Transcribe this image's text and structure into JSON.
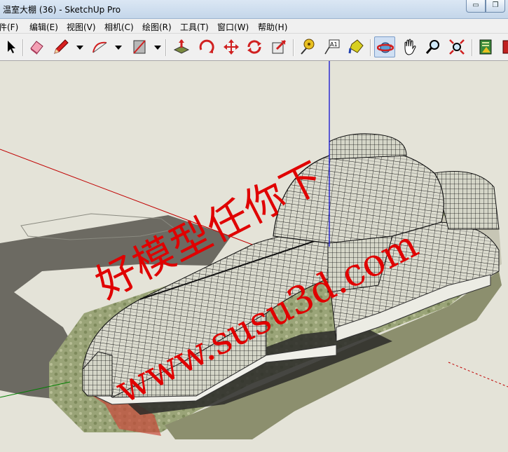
{
  "window": {
    "title": "温室大棚 (36) - SketchUp Pro",
    "controls": {
      "minimize": "▭",
      "restore": "❐"
    }
  },
  "menu": {
    "items": [
      {
        "label": "文件(F)"
      },
      {
        "label": "编辑(E)"
      },
      {
        "label": "视图(V)"
      },
      {
        "label": "相机(C)"
      },
      {
        "label": "绘图(R)"
      },
      {
        "label": "工具(T)"
      },
      {
        "label": "窗口(W)"
      },
      {
        "label": "帮助(H)"
      }
    ]
  },
  "toolbar": {
    "tools": [
      {
        "name": "select-tool"
      },
      {
        "name": "eraser-tool"
      },
      {
        "name": "pencil-tool"
      },
      {
        "name": "arc-tool"
      },
      {
        "name": "rectangle-tool"
      },
      {
        "name": "push-pull-tool"
      },
      {
        "name": "rotate-tool"
      },
      {
        "name": "move-tool"
      },
      {
        "name": "follow-me-tool"
      },
      {
        "name": "offset-tool"
      },
      {
        "name": "tape-measure-tool"
      },
      {
        "name": "text-tool"
      },
      {
        "name": "paint-bucket-tool"
      },
      {
        "name": "orbit-tool",
        "active": true
      },
      {
        "name": "pan-tool"
      },
      {
        "name": "zoom-tool"
      },
      {
        "name": "zoom-extents-tool"
      },
      {
        "name": "3d-warehouse-tool"
      },
      {
        "name": "extension-tool"
      }
    ],
    "text_tool_label": "A1"
  },
  "viewport": {
    "model": "greenhouse",
    "axis_colors": {
      "red": "#c00000",
      "green": "#008000",
      "blue": "#0000d0"
    },
    "sky_color": "#e4e3d8",
    "ground_color": "#d6d3c2"
  },
  "watermark": {
    "line1": "好模型任你下",
    "line2": "www.susu3d.com",
    "color": "#e00000"
  }
}
